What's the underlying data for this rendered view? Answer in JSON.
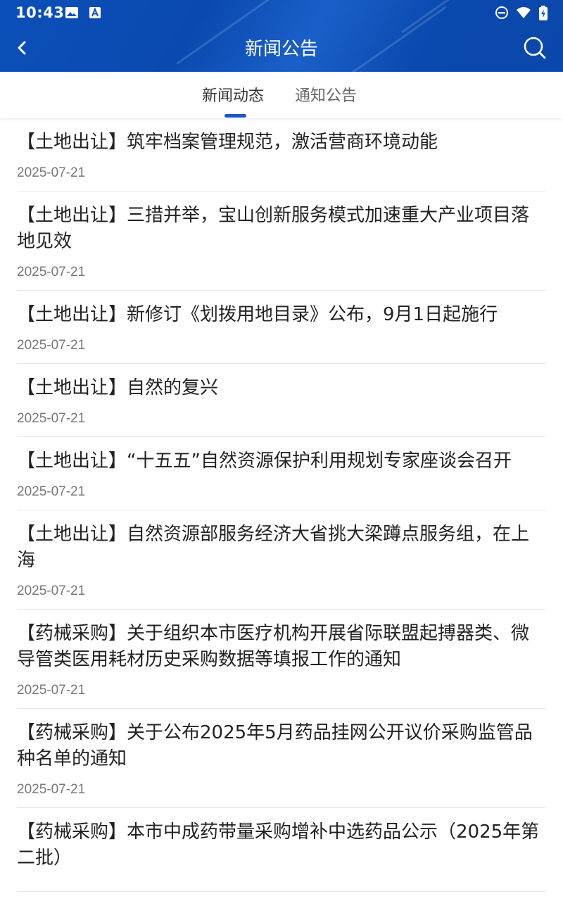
{
  "status_bar": {
    "time": "10:43"
  },
  "header": {
    "title": "新闻公告"
  },
  "tabs": [
    {
      "label": "新闻动态"
    },
    {
      "label": "通知公告"
    }
  ],
  "news": [
    {
      "title": "【土地出让】筑牢档案管理规范，激活营商环境动能",
      "date": "2025-07-21"
    },
    {
      "title": "【土地出让】三措并举，宝山创新服务模式加速重大产业项目落地见效",
      "date": "2025-07-21"
    },
    {
      "title": "【土地出让】新修订《划拨用地目录》公布，9月1日起施行",
      "date": "2025-07-21"
    },
    {
      "title": "【土地出让】自然的复兴",
      "date": "2025-07-21"
    },
    {
      "title": "【土地出让】“十五五”自然资源保护利用规划专家座谈会召开",
      "date": "2025-07-21"
    },
    {
      "title": "【土地出让】自然资源部服务经济大省挑大梁蹲点服务组，在上海",
      "date": "2025-07-21"
    },
    {
      "title": "【药械采购】关于组织本市医疗机构开展省际联盟起搏器类、微导管类医用耗材历史采购数据等填报工作的通知",
      "date": "2025-07-21"
    },
    {
      "title": "【药械采购】关于公布2025年5月药品挂网公开议价采购监管品种名单的通知",
      "date": "2025-07-21"
    },
    {
      "title": "【药械采购】本市中成药带量采购增补中选药品公示（2025年第二批）",
      "date": ""
    }
  ]
}
